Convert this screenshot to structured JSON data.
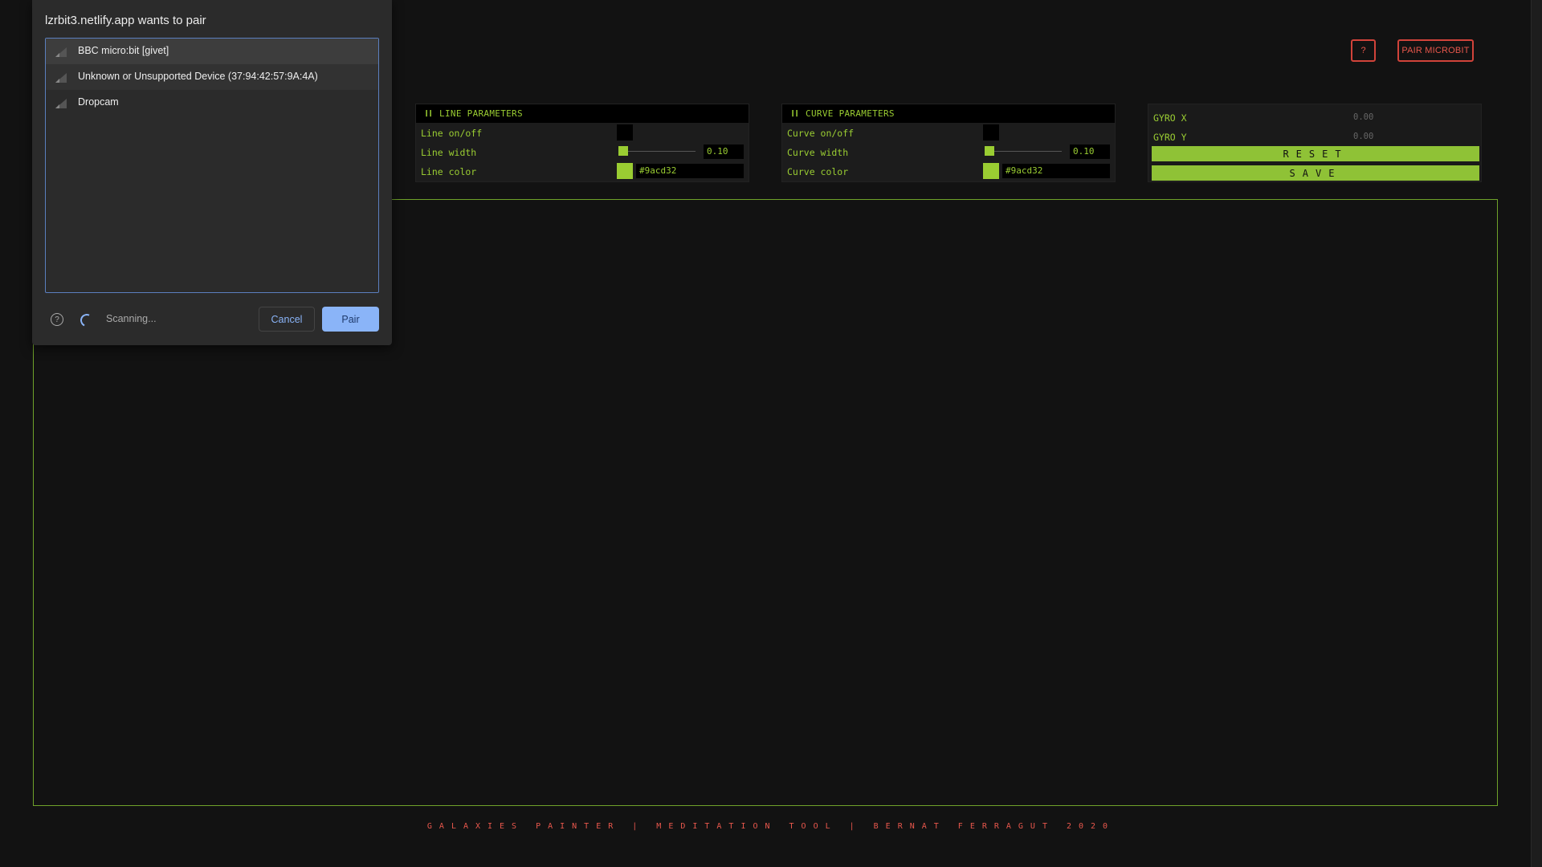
{
  "header": {
    "help_label": "?",
    "pair_label": "PAIR MICROBIT"
  },
  "line_panel": {
    "title": "LINE PARAMETERS",
    "onoff_label": "Line on/off",
    "width_label": "Line width",
    "width_value": "0.10",
    "color_label": "Line color",
    "color_value": "#9acd32"
  },
  "curve_panel": {
    "title": "CURVE PARAMETERS",
    "onoff_label": "Curve on/off",
    "width_label": "Curve width",
    "width_value": "0.10",
    "color_label": "Curve color",
    "color_value": "#9acd32"
  },
  "gyro_panel": {
    "gyro_x_label": "GYRO X",
    "gyro_x_value": "0.00",
    "gyro_y_label": "GYRO Y",
    "gyro_y_value": "0.00",
    "reset_label": "RESET",
    "save_label": "SAVE"
  },
  "footer": {
    "text": "GALAXIES PAINTER | MEDITATION TOOL | BERNAT FERRAGUT 2020"
  },
  "dialog": {
    "title": "lzrbit3.netlify.app wants to pair",
    "devices": [
      {
        "name": "BBC micro:bit [givet]"
      },
      {
        "name": "Unknown or Unsupported Device (37:94:42:57:9A:4A)"
      },
      {
        "name": "Dropcam"
      }
    ],
    "help_symbol": "?",
    "status": "Scanning...",
    "cancel_label": "Cancel",
    "pair_label": "Pair"
  },
  "colors": {
    "accent_green": "#9acd32",
    "accent_red": "#e8574c",
    "dialog_blue": "#8ab4f8"
  },
  "icons": [
    "pause-icon",
    "signal-icon",
    "help-icon",
    "spinner-icon"
  ]
}
